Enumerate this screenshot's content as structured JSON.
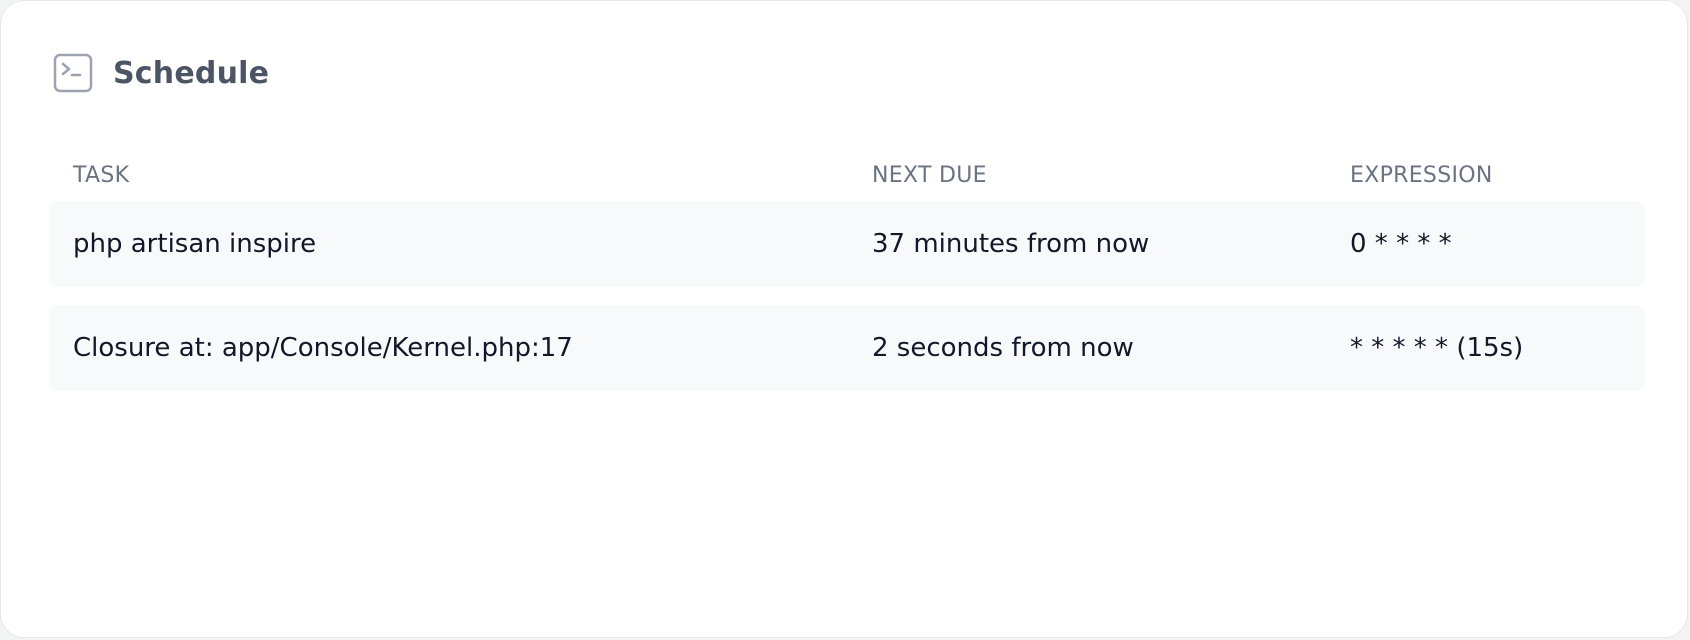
{
  "panel": {
    "title": "Schedule",
    "icon": "terminal-icon"
  },
  "table": {
    "headers": {
      "task": "TASK",
      "next_due": "NEXT DUE",
      "expression": "EXPRESSION"
    },
    "rows": [
      {
        "task": "php artisan inspire",
        "next_due": "37 minutes from now",
        "expression": "0 * * * *"
      },
      {
        "task": "Closure at: app/Console/Kernel.php:17",
        "next_due": "2 seconds from now",
        "expression": "* * * * * (15s)"
      }
    ]
  },
  "colors": {
    "card_background": "#ffffff",
    "row_background": "#f8f9fb",
    "header_text": "#6b7280",
    "title_text": "#4b5563",
    "body_text": "#111827",
    "icon_stroke": "#9ca3af"
  }
}
